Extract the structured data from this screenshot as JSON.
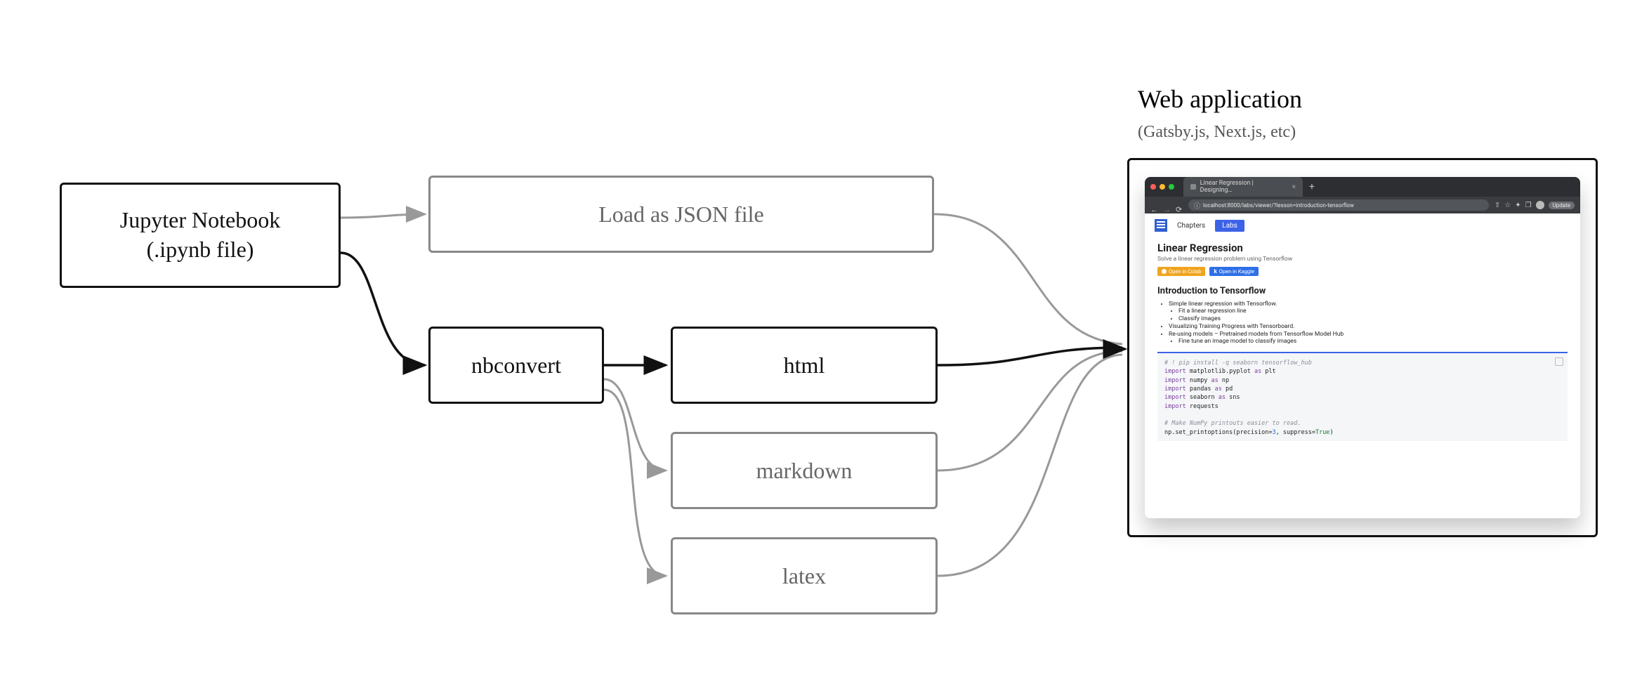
{
  "diagram": {
    "node_jupyter": {
      "line1": "Jupyter Notebook",
      "line2": "(.ipynb file)"
    },
    "node_loadjson": "Load as JSON file",
    "node_nbconvert": "nbconvert",
    "node_html": "html",
    "node_markdown": "markdown",
    "node_latex": "latex",
    "webapp_title": "Web application",
    "webapp_sub": "(Gatsby.js, Next.js, etc)"
  },
  "browser": {
    "tab_title": "Linear Regression | Designing…",
    "url": "localhost:8000/labs/viewer/?lesson=introduction-tensorflow",
    "update_label": "Update",
    "nav": {
      "chapters": "Chapters",
      "labs": "Labs"
    },
    "page": {
      "title": "Linear Regression",
      "subtitle": "Solve a linear regression problem using Tensorflow",
      "badge_colab": "Open in Colab",
      "badge_kaggle": "Open in Kaggle",
      "section": "Introduction to Tensorflow",
      "bullets": {
        "b1": "Simple linear regression with Tensorflow.",
        "b1a": "Fit a linear regression line",
        "b1b": "Classify images",
        "b2": "Visualizing Training Progress with Tensorboard.",
        "b3": "Re-using models – Pretrained models from Tensorflow Model Hub",
        "b3a": "Fine tune an image model to classify images"
      },
      "code": {
        "c1": "# ! pip install -q seaborn tensorflow_hub",
        "c2a": "import",
        "c2b": " matplotlib.pyplot ",
        "c2c": "as",
        "c2d": " plt",
        "c3a": "import",
        "c3b": " numpy ",
        "c3c": "as",
        "c3d": " np",
        "c4a": "import",
        "c4b": " pandas ",
        "c4c": "as",
        "c4d": " pd",
        "c5a": "import",
        "c5b": " seaborn ",
        "c5c": "as",
        "c5d": " sns",
        "c6a": "import",
        "c6b": " requests",
        "c7": "# Make NumPy printouts easier to read.",
        "c8a": "np.set_printoptions(precision=",
        "c8b": "3",
        "c8c": ", suppress=",
        "c8d": "True",
        "c8e": ")"
      }
    }
  }
}
